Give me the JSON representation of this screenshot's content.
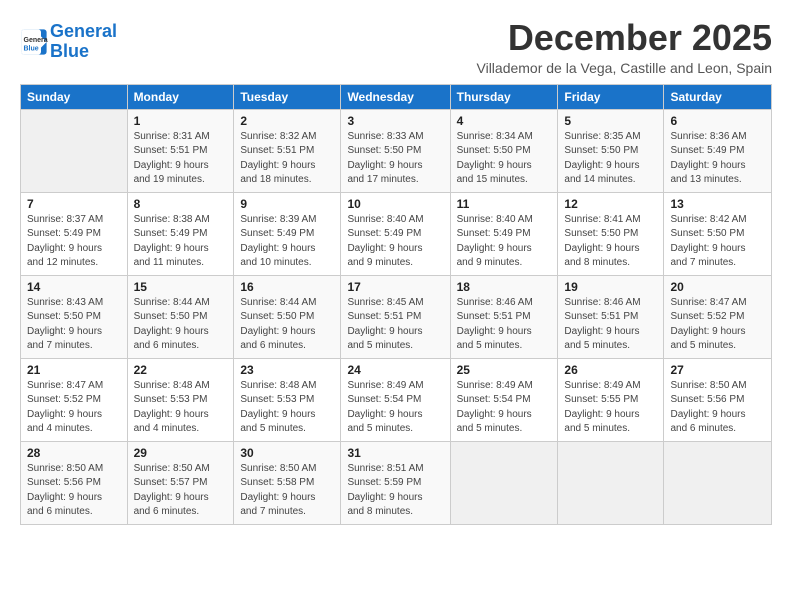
{
  "header": {
    "logo_line1": "General",
    "logo_line2": "Blue",
    "title": "December 2025",
    "subtitle": "Villademor de la Vega, Castille and Leon, Spain"
  },
  "columns": [
    "Sunday",
    "Monday",
    "Tuesday",
    "Wednesday",
    "Thursday",
    "Friday",
    "Saturday"
  ],
  "weeks": [
    [
      {
        "day": "",
        "info": ""
      },
      {
        "day": "1",
        "info": "Sunrise: 8:31 AM\nSunset: 5:51 PM\nDaylight: 9 hours\nand 19 minutes."
      },
      {
        "day": "2",
        "info": "Sunrise: 8:32 AM\nSunset: 5:51 PM\nDaylight: 9 hours\nand 18 minutes."
      },
      {
        "day": "3",
        "info": "Sunrise: 8:33 AM\nSunset: 5:50 PM\nDaylight: 9 hours\nand 17 minutes."
      },
      {
        "day": "4",
        "info": "Sunrise: 8:34 AM\nSunset: 5:50 PM\nDaylight: 9 hours\nand 15 minutes."
      },
      {
        "day": "5",
        "info": "Sunrise: 8:35 AM\nSunset: 5:50 PM\nDaylight: 9 hours\nand 14 minutes."
      },
      {
        "day": "6",
        "info": "Sunrise: 8:36 AM\nSunset: 5:49 PM\nDaylight: 9 hours\nand 13 minutes."
      }
    ],
    [
      {
        "day": "7",
        "info": "Sunrise: 8:37 AM\nSunset: 5:49 PM\nDaylight: 9 hours\nand 12 minutes."
      },
      {
        "day": "8",
        "info": "Sunrise: 8:38 AM\nSunset: 5:49 PM\nDaylight: 9 hours\nand 11 minutes."
      },
      {
        "day": "9",
        "info": "Sunrise: 8:39 AM\nSunset: 5:49 PM\nDaylight: 9 hours\nand 10 minutes."
      },
      {
        "day": "10",
        "info": "Sunrise: 8:40 AM\nSunset: 5:49 PM\nDaylight: 9 hours\nand 9 minutes."
      },
      {
        "day": "11",
        "info": "Sunrise: 8:40 AM\nSunset: 5:49 PM\nDaylight: 9 hours\nand 9 minutes."
      },
      {
        "day": "12",
        "info": "Sunrise: 8:41 AM\nSunset: 5:50 PM\nDaylight: 9 hours\nand 8 minutes."
      },
      {
        "day": "13",
        "info": "Sunrise: 8:42 AM\nSunset: 5:50 PM\nDaylight: 9 hours\nand 7 minutes."
      }
    ],
    [
      {
        "day": "14",
        "info": "Sunrise: 8:43 AM\nSunset: 5:50 PM\nDaylight: 9 hours\nand 7 minutes."
      },
      {
        "day": "15",
        "info": "Sunrise: 8:44 AM\nSunset: 5:50 PM\nDaylight: 9 hours\nand 6 minutes."
      },
      {
        "day": "16",
        "info": "Sunrise: 8:44 AM\nSunset: 5:50 PM\nDaylight: 9 hours\nand 6 minutes."
      },
      {
        "day": "17",
        "info": "Sunrise: 8:45 AM\nSunset: 5:51 PM\nDaylight: 9 hours\nand 5 minutes."
      },
      {
        "day": "18",
        "info": "Sunrise: 8:46 AM\nSunset: 5:51 PM\nDaylight: 9 hours\nand 5 minutes."
      },
      {
        "day": "19",
        "info": "Sunrise: 8:46 AM\nSunset: 5:51 PM\nDaylight: 9 hours\nand 5 minutes."
      },
      {
        "day": "20",
        "info": "Sunrise: 8:47 AM\nSunset: 5:52 PM\nDaylight: 9 hours\nand 5 minutes."
      }
    ],
    [
      {
        "day": "21",
        "info": "Sunrise: 8:47 AM\nSunset: 5:52 PM\nDaylight: 9 hours\nand 4 minutes."
      },
      {
        "day": "22",
        "info": "Sunrise: 8:48 AM\nSunset: 5:53 PM\nDaylight: 9 hours\nand 4 minutes."
      },
      {
        "day": "23",
        "info": "Sunrise: 8:48 AM\nSunset: 5:53 PM\nDaylight: 9 hours\nand 5 minutes."
      },
      {
        "day": "24",
        "info": "Sunrise: 8:49 AM\nSunset: 5:54 PM\nDaylight: 9 hours\nand 5 minutes."
      },
      {
        "day": "25",
        "info": "Sunrise: 8:49 AM\nSunset: 5:54 PM\nDaylight: 9 hours\nand 5 minutes."
      },
      {
        "day": "26",
        "info": "Sunrise: 8:49 AM\nSunset: 5:55 PM\nDaylight: 9 hours\nand 5 minutes."
      },
      {
        "day": "27",
        "info": "Sunrise: 8:50 AM\nSunset: 5:56 PM\nDaylight: 9 hours\nand 6 minutes."
      }
    ],
    [
      {
        "day": "28",
        "info": "Sunrise: 8:50 AM\nSunset: 5:56 PM\nDaylight: 9 hours\nand 6 minutes."
      },
      {
        "day": "29",
        "info": "Sunrise: 8:50 AM\nSunset: 5:57 PM\nDaylight: 9 hours\nand 6 minutes."
      },
      {
        "day": "30",
        "info": "Sunrise: 8:50 AM\nSunset: 5:58 PM\nDaylight: 9 hours\nand 7 minutes."
      },
      {
        "day": "31",
        "info": "Sunrise: 8:51 AM\nSunset: 5:59 PM\nDaylight: 9 hours\nand 8 minutes."
      },
      {
        "day": "",
        "info": ""
      },
      {
        "day": "",
        "info": ""
      },
      {
        "day": "",
        "info": ""
      }
    ]
  ]
}
